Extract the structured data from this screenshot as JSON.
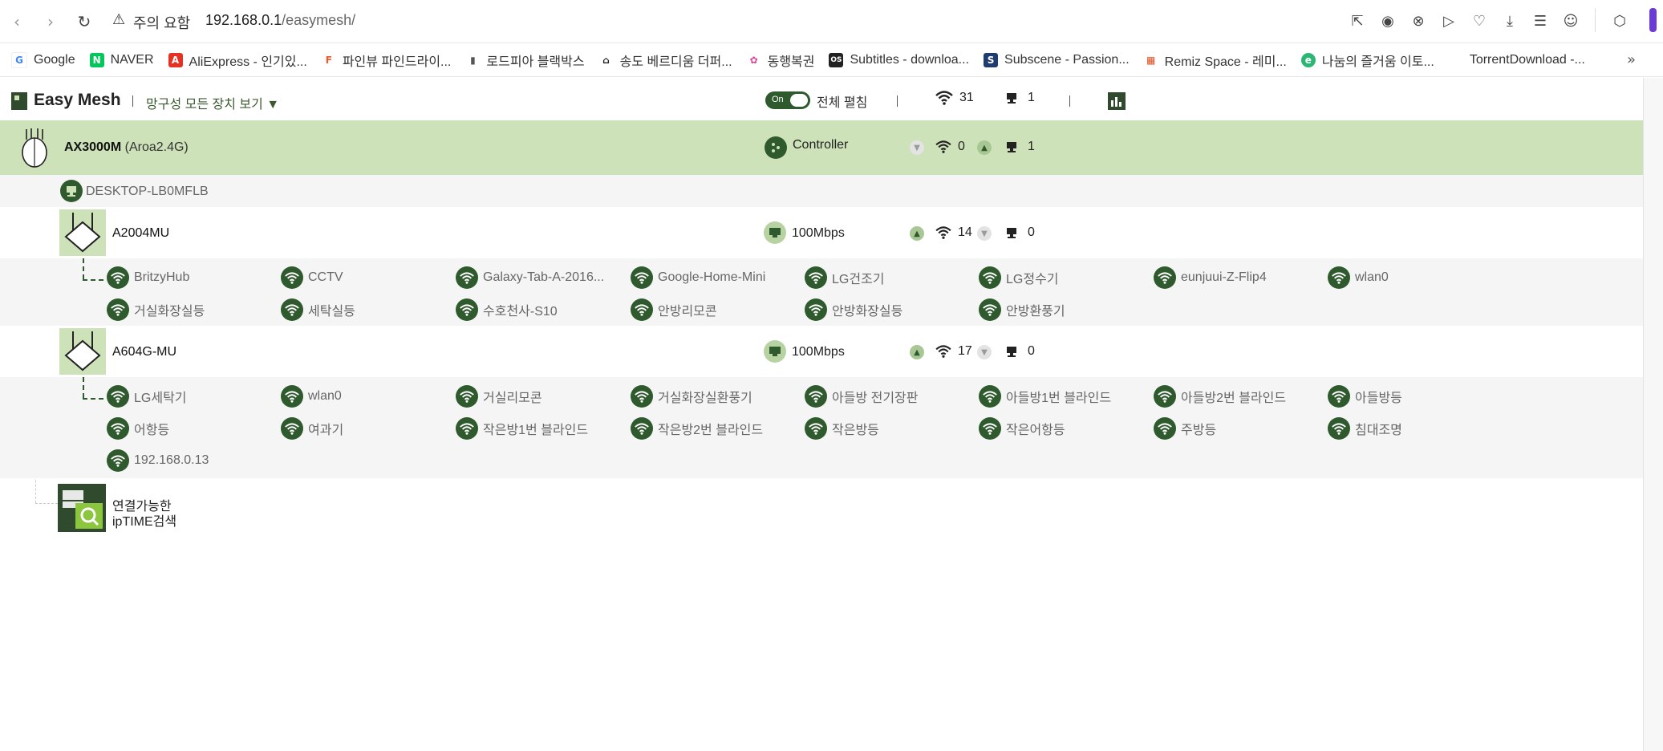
{
  "browser": {
    "security_label": "주의 요함",
    "url_host": "192.168.0.1",
    "url_path": "/easymesh/",
    "accent_color": "#6b3bd6"
  },
  "bookmarks": [
    {
      "label": "Google",
      "icon": "G",
      "color": "#ffffff",
      "text_color": "#4285f4"
    },
    {
      "label": "NAVER",
      "icon": "N",
      "color": "#03c75a",
      "text_color": "#ffffff"
    },
    {
      "label": "AliExpress - 인기있...",
      "icon": "A",
      "color": "#e43225",
      "text_color": "#ffffff"
    },
    {
      "label": "파인뷰 파인드라이...",
      "icon": "F",
      "color": "#ffffff",
      "text_color": "#f05a28"
    },
    {
      "label": "로드피아 블랙박스",
      "icon": "▮",
      "color": "#ffffff",
      "text_color": "#555555"
    },
    {
      "label": "송도 베르디움 더퍼...",
      "icon": "⌂",
      "color": "#ffffff",
      "text_color": "#222222"
    },
    {
      "label": "동행복권",
      "icon": "✿",
      "color": "#ffffff",
      "text_color": "#e0409a"
    },
    {
      "label": "Subtitles - downloa...",
      "icon": "OS",
      "color": "#222222",
      "text_color": "#ffffff"
    },
    {
      "label": "Subscene - Passion...",
      "icon": "S",
      "color": "#1f3c6e",
      "text_color": "#ffffff"
    },
    {
      "label": "Remiz Space - 레미...",
      "icon": "▦",
      "color": "#ffffff",
      "text_color": "#e64a19"
    },
    {
      "label": "나눔의 즐거움 이토...",
      "icon": "e",
      "color": "#2bb673",
      "text_color": "#ffffff"
    },
    {
      "label": "TorrentDownload -...",
      "icon": "",
      "color": "#ffffff",
      "text_color": "#ffffff"
    }
  ],
  "header": {
    "title": "Easy Mesh",
    "view_all": "망구성 모든 장치 보기 ▼",
    "toggle_label": "On",
    "expand_label": "전체 펼침",
    "wifi_total": "31",
    "wired_total": "1"
  },
  "controller": {
    "model": "AX3000M",
    "ssid": "(Aroa2.4G)",
    "role": "Controller",
    "wifi_count": "0",
    "wired_count": "1"
  },
  "wired_client": {
    "name": "DESKTOP-LB0MFLB"
  },
  "agents": [
    {
      "name": "A2004MU",
      "speed": "100Mbps",
      "wifi_count": "14",
      "wired_count": "0",
      "clients": [
        "BritzyHub",
        "CCTV",
        "Galaxy-Tab-A-2016...",
        "Google-Home-Mini",
        "LG건조기",
        "LG정수기",
        "eunjuui-Z-Flip4",
        "wlan0",
        "거실화장실등",
        "세탁실등",
        "수호천사-S10",
        "안방리모콘",
        "안방화장실등",
        "안방환풍기"
      ]
    },
    {
      "name": "A604G-MU",
      "speed": "100Mbps",
      "wifi_count": "17",
      "wired_count": "0",
      "clients": [
        "LG세탁기",
        "wlan0",
        "거실리모콘",
        "거실화장실환풍기",
        "아들방 전기장판",
        "아들방1번 블라인드",
        "아들방2번 블라인드",
        "아들방등",
        "어항등",
        "여과기",
        "작은방1번 블라인드",
        "작은방2번 블라인드",
        "작은방등",
        "작은어항등",
        "주방등",
        "침대조명",
        "192.168.0.13"
      ]
    }
  ],
  "search": {
    "line1": "연결가능한",
    "line2": "ipTIME검색"
  },
  "colors": {
    "dark_green": "#2f5a2e",
    "light_green": "#cde2b8",
    "row_gray": "#f5f5f5"
  }
}
